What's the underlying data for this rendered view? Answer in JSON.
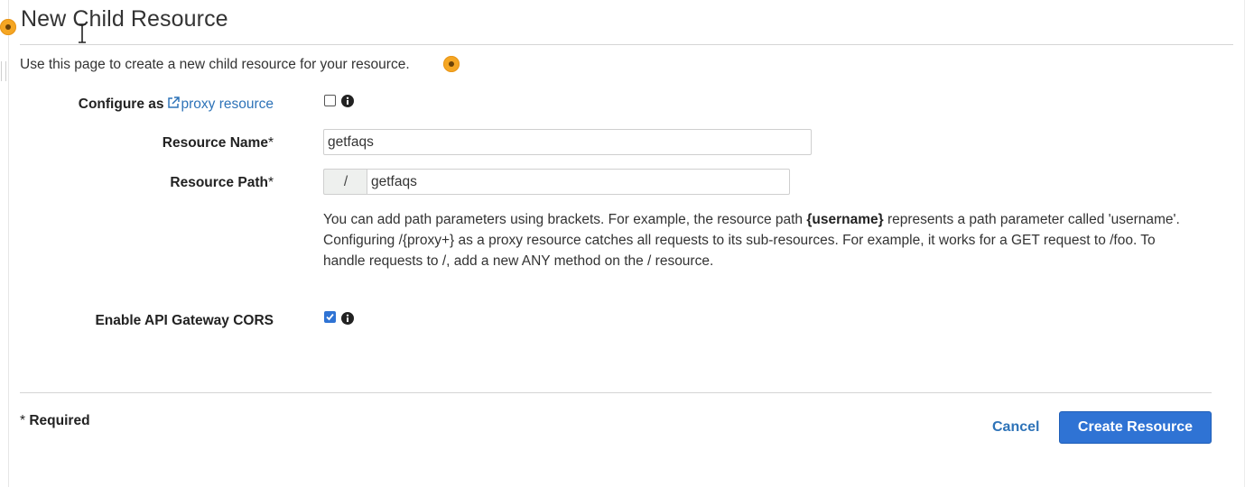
{
  "page": {
    "title": "New Child Resource",
    "intro": "Use this page to create a new child resource for your resource."
  },
  "form": {
    "proxy": {
      "label_prefix": "Configure as",
      "link_text": "proxy resource",
      "checked": false
    },
    "resource_name": {
      "label": "Resource Name",
      "required_mark": "*",
      "value": "getfaqs"
    },
    "resource_path": {
      "label": "Resource Path",
      "required_mark": "*",
      "prefix": "/",
      "value": "getfaqs"
    },
    "help": {
      "p1": "You can add path parameters using brackets. For example, the resource path ",
      "bold": "{username}",
      "p2": " represents a path parameter called 'username'. Configuring /{proxy+} as a proxy resource catches all requests to its sub-resources. For example, it works for a GET request to /foo. To handle requests to /, add a new ANY method on the / resource."
    },
    "cors": {
      "label": "Enable API Gateway CORS",
      "checked": true
    }
  },
  "footer": {
    "required_mark": "*",
    "required_text": "Required",
    "cancel_label": "Cancel",
    "create_label": "Create Resource"
  },
  "colors": {
    "accent": "#2f73d4",
    "link": "#2e73b8",
    "hotspot": "#f5a623"
  }
}
